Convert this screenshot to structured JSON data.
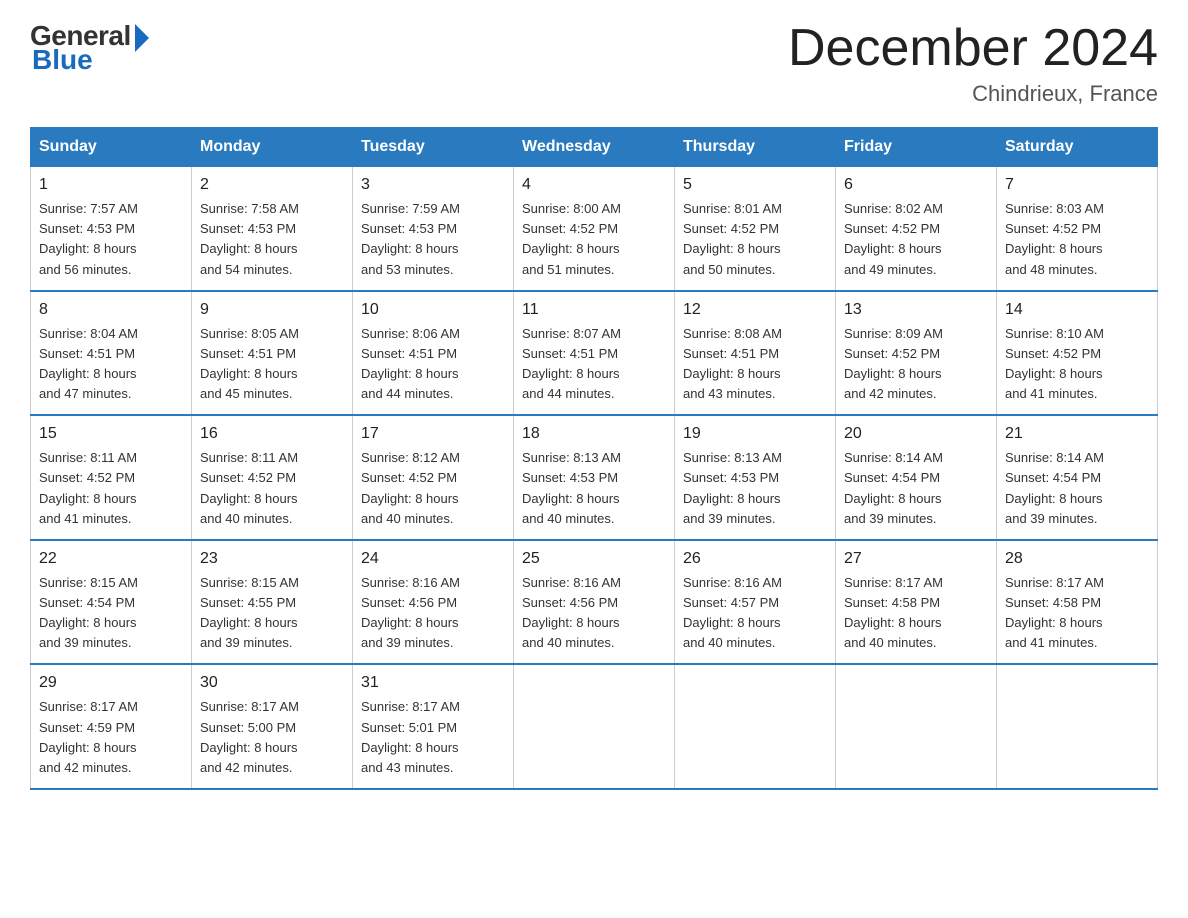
{
  "logo": {
    "general": "General",
    "blue": "Blue"
  },
  "title": "December 2024",
  "location": "Chindrieux, France",
  "days_of_week": [
    "Sunday",
    "Monday",
    "Tuesday",
    "Wednesday",
    "Thursday",
    "Friday",
    "Saturday"
  ],
  "weeks": [
    [
      {
        "day": "1",
        "sunrise": "7:57 AM",
        "sunset": "4:53 PM",
        "daylight": "8 hours and 56 minutes."
      },
      {
        "day": "2",
        "sunrise": "7:58 AM",
        "sunset": "4:53 PM",
        "daylight": "8 hours and 54 minutes."
      },
      {
        "day": "3",
        "sunrise": "7:59 AM",
        "sunset": "4:53 PM",
        "daylight": "8 hours and 53 minutes."
      },
      {
        "day": "4",
        "sunrise": "8:00 AM",
        "sunset": "4:52 PM",
        "daylight": "8 hours and 51 minutes."
      },
      {
        "day": "5",
        "sunrise": "8:01 AM",
        "sunset": "4:52 PM",
        "daylight": "8 hours and 50 minutes."
      },
      {
        "day": "6",
        "sunrise": "8:02 AM",
        "sunset": "4:52 PM",
        "daylight": "8 hours and 49 minutes."
      },
      {
        "day": "7",
        "sunrise": "8:03 AM",
        "sunset": "4:52 PM",
        "daylight": "8 hours and 48 minutes."
      }
    ],
    [
      {
        "day": "8",
        "sunrise": "8:04 AM",
        "sunset": "4:51 PM",
        "daylight": "8 hours and 47 minutes."
      },
      {
        "day": "9",
        "sunrise": "8:05 AM",
        "sunset": "4:51 PM",
        "daylight": "8 hours and 45 minutes."
      },
      {
        "day": "10",
        "sunrise": "8:06 AM",
        "sunset": "4:51 PM",
        "daylight": "8 hours and 44 minutes."
      },
      {
        "day": "11",
        "sunrise": "8:07 AM",
        "sunset": "4:51 PM",
        "daylight": "8 hours and 44 minutes."
      },
      {
        "day": "12",
        "sunrise": "8:08 AM",
        "sunset": "4:51 PM",
        "daylight": "8 hours and 43 minutes."
      },
      {
        "day": "13",
        "sunrise": "8:09 AM",
        "sunset": "4:52 PM",
        "daylight": "8 hours and 42 minutes."
      },
      {
        "day": "14",
        "sunrise": "8:10 AM",
        "sunset": "4:52 PM",
        "daylight": "8 hours and 41 minutes."
      }
    ],
    [
      {
        "day": "15",
        "sunrise": "8:11 AM",
        "sunset": "4:52 PM",
        "daylight": "8 hours and 41 minutes."
      },
      {
        "day": "16",
        "sunrise": "8:11 AM",
        "sunset": "4:52 PM",
        "daylight": "8 hours and 40 minutes."
      },
      {
        "day": "17",
        "sunrise": "8:12 AM",
        "sunset": "4:52 PM",
        "daylight": "8 hours and 40 minutes."
      },
      {
        "day": "18",
        "sunrise": "8:13 AM",
        "sunset": "4:53 PM",
        "daylight": "8 hours and 40 minutes."
      },
      {
        "day": "19",
        "sunrise": "8:13 AM",
        "sunset": "4:53 PM",
        "daylight": "8 hours and 39 minutes."
      },
      {
        "day": "20",
        "sunrise": "8:14 AM",
        "sunset": "4:54 PM",
        "daylight": "8 hours and 39 minutes."
      },
      {
        "day": "21",
        "sunrise": "8:14 AM",
        "sunset": "4:54 PM",
        "daylight": "8 hours and 39 minutes."
      }
    ],
    [
      {
        "day": "22",
        "sunrise": "8:15 AM",
        "sunset": "4:54 PM",
        "daylight": "8 hours and 39 minutes."
      },
      {
        "day": "23",
        "sunrise": "8:15 AM",
        "sunset": "4:55 PM",
        "daylight": "8 hours and 39 minutes."
      },
      {
        "day": "24",
        "sunrise": "8:16 AM",
        "sunset": "4:56 PM",
        "daylight": "8 hours and 39 minutes."
      },
      {
        "day": "25",
        "sunrise": "8:16 AM",
        "sunset": "4:56 PM",
        "daylight": "8 hours and 40 minutes."
      },
      {
        "day": "26",
        "sunrise": "8:16 AM",
        "sunset": "4:57 PM",
        "daylight": "8 hours and 40 minutes."
      },
      {
        "day": "27",
        "sunrise": "8:17 AM",
        "sunset": "4:58 PM",
        "daylight": "8 hours and 40 minutes."
      },
      {
        "day": "28",
        "sunrise": "8:17 AM",
        "sunset": "4:58 PM",
        "daylight": "8 hours and 41 minutes."
      }
    ],
    [
      {
        "day": "29",
        "sunrise": "8:17 AM",
        "sunset": "4:59 PM",
        "daylight": "8 hours and 42 minutes."
      },
      {
        "day": "30",
        "sunrise": "8:17 AM",
        "sunset": "5:00 PM",
        "daylight": "8 hours and 42 minutes."
      },
      {
        "day": "31",
        "sunrise": "8:17 AM",
        "sunset": "5:01 PM",
        "daylight": "8 hours and 43 minutes."
      },
      null,
      null,
      null,
      null
    ]
  ],
  "labels": {
    "sunrise": "Sunrise:",
    "sunset": "Sunset:",
    "daylight": "Daylight:"
  }
}
